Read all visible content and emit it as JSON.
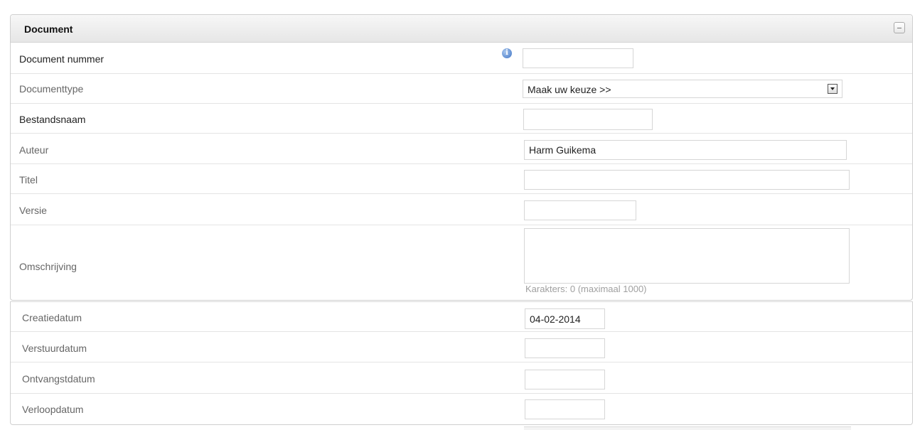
{
  "panel": {
    "title": "Document"
  },
  "fields": {
    "document_nummer": {
      "label": "Document nummer",
      "value": ""
    },
    "documenttype": {
      "label": "Documenttype",
      "selected": "Maak uw keuze >>"
    },
    "bestandsnaam": {
      "label": "Bestandsnaam",
      "value": ""
    },
    "auteur": {
      "label": "Auteur",
      "value": "Harm Guikema"
    },
    "titel": {
      "label": "Titel",
      "value": ""
    },
    "versie": {
      "label": "Versie",
      "value": ""
    },
    "omschrijving": {
      "label": "Omschrijving",
      "value": "",
      "charcount": "Karakters: 0 (maximaal 1000)"
    },
    "creatiedatum": {
      "label": "Creatiedatum",
      "value": "04-02-2014"
    },
    "verstuurdatum": {
      "label": "Verstuurdatum",
      "value": ""
    },
    "ontvangstdatum": {
      "label": "Ontvangstdatum",
      "value": ""
    },
    "verloopdatum": {
      "label": "Verloopdatum",
      "value": ""
    }
  },
  "icons": {
    "info": "info-icon",
    "collapse": "collapse-icon",
    "dropdown": "chevron-down-icon"
  },
  "colors": {
    "info_icon": "#3f74c5",
    "border": "#cfcfcf"
  }
}
